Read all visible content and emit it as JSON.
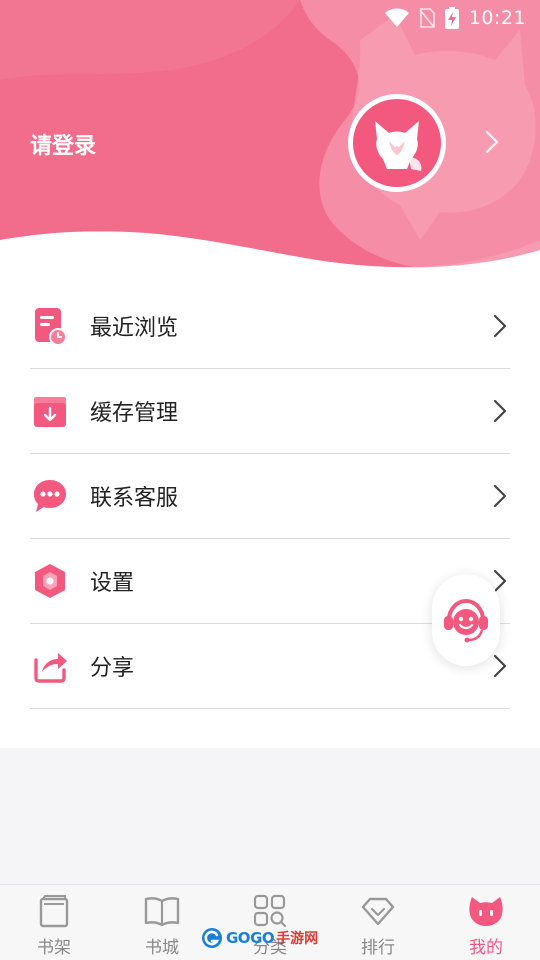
{
  "status_bar": {
    "time": "10:21"
  },
  "header": {
    "login_label": "请登录"
  },
  "menu": {
    "items": [
      {
        "label": "最近浏览",
        "icon": "recent-browse-icon"
      },
      {
        "label": "缓存管理",
        "icon": "cache-download-icon"
      },
      {
        "label": "联系客服",
        "icon": "chat-bubble-icon"
      },
      {
        "label": "设置",
        "icon": "settings-hexagon-icon"
      },
      {
        "label": "分享",
        "icon": "share-icon"
      }
    ]
  },
  "tabbar": {
    "tabs": [
      {
        "label": "书架",
        "icon": "bookshelf-icon",
        "active": false
      },
      {
        "label": "书城",
        "icon": "open-book-icon",
        "active": false
      },
      {
        "label": "分类",
        "icon": "category-grid-icon",
        "active": false
      },
      {
        "label": "排行",
        "icon": "ranking-diamond-icon",
        "active": false
      },
      {
        "label": "我的",
        "icon": "profile-face-icon",
        "active": true
      }
    ]
  },
  "watermark": {
    "text": "GOGO",
    "text2": "手游网"
  },
  "colors": {
    "accent": "#f0587f",
    "header_pink": "#f06f8c",
    "header_light": "#f69ab0"
  }
}
